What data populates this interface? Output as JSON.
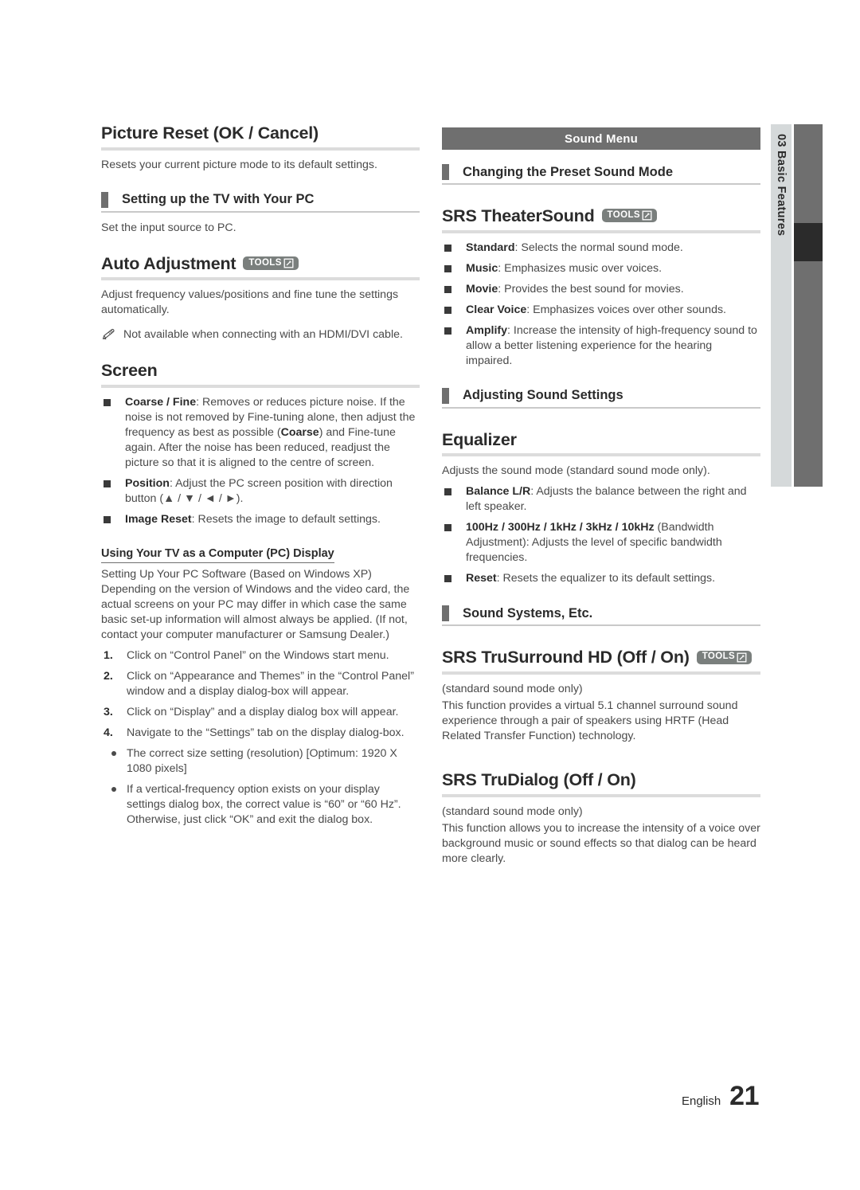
{
  "document": {
    "banner": "Sound Menu",
    "side_tab": {
      "number": "03",
      "label": "Basic Features",
      "combined": "03  Basic Features"
    },
    "footer": {
      "language": "English",
      "page_number": "21"
    },
    "colors": {
      "banner_bg": "#6f6f6f",
      "side_tab_bg": "#d5d9da",
      "sidebar_strip": "#6f6f6f",
      "sidebar_marker": "#2b2b2b",
      "tools_badge": "#7a7f7d",
      "heading_rule": "#dcdcdc",
      "text": "#4a4a4a"
    }
  },
  "left_column": {
    "picture_reset": {
      "title": "Picture Reset (OK / Cancel)",
      "body": "Resets your current picture mode to its default settings."
    },
    "setting_up_tv": {
      "section_title": "Setting up the TV with Your PC",
      "body": "Set the input source to PC."
    },
    "auto_adjustment": {
      "title": "Auto Adjustment",
      "tools_label": "TOOLS",
      "body": "Adjust frequency values/positions and fine tune the settings automatically.",
      "note": "Not available when connecting with an HDMI/DVI cable."
    },
    "screen": {
      "title": "Screen",
      "items": [
        {
          "term": "Coarse / Fine",
          "desc": ": Removes or reduces picture noise. If the noise is not removed by Fine-tuning alone, then adjust the frequency as best as possible (",
          "term2": "Coarse",
          "desc2": ") and Fine-tune again. After the noise has been reduced, readjust the picture so that it is aligned to the centre of screen."
        },
        {
          "term": "Position",
          "desc": ": Adjust the PC screen position with direction button (▲ / ▼ / ◄ / ►)."
        },
        {
          "term": "Image Reset",
          "desc": ": Resets the image to default settings."
        }
      ]
    },
    "pc_display": {
      "subhead": "Using Your TV as a Computer (PC) Display",
      "intro": "Setting Up Your PC Software (Based on Windows XP) Depending on the version of Windows and the video card, the actual screens on your PC may differ in which case the same basic set-up information will almost always be applied. (If not, contact your computer manufacturer or Samsung Dealer.)",
      "steps": [
        {
          "n": "1.",
          "text": "Click on “Control Panel” on the Windows start menu."
        },
        {
          "n": "2.",
          "text": "Click on “Appearance and Themes” in the “Control Panel” window and a display dialog-box will appear."
        },
        {
          "n": "3.",
          "text": "Click on “Display” and a display dialog box will appear."
        },
        {
          "n": "4.",
          "text": "Navigate to the “Settings” tab on the display dialog-box."
        }
      ],
      "bullets": [
        "The correct size setting (resolution) [Optimum: 1920 X 1080 pixels]",
        "If a vertical-frequency option exists on your display settings dialog box, the correct value is “60” or “60 Hz”. Otherwise, just click “OK” and exit the dialog box."
      ]
    }
  },
  "right_column": {
    "preset_sound_mode": {
      "section_title": "Changing the Preset Sound Mode"
    },
    "srs_theatersound": {
      "title": "SRS TheaterSound",
      "tools_label": "TOOLS",
      "items": [
        {
          "term": "Standard",
          "desc": ": Selects the normal sound mode."
        },
        {
          "term": "Music",
          "desc": ": Emphasizes music over voices."
        },
        {
          "term": "Movie",
          "desc": ": Provides the best sound for movies."
        },
        {
          "term": "Clear Voice",
          "desc": ": Emphasizes voices over other sounds."
        },
        {
          "term": "Amplify",
          "desc": ": Increase the intensity of high-frequency sound to allow a better listening experience for the hearing impaired."
        }
      ]
    },
    "adjusting_sound_settings": {
      "section_title": "Adjusting Sound Settings"
    },
    "equalizer": {
      "title": "Equalizer",
      "body": "Adjusts the sound mode (standard sound mode only).",
      "items": [
        {
          "term": "Balance L/R",
          "desc": ": Adjusts the balance between the right and left speaker."
        },
        {
          "term": "100Hz / 300Hz / 1kHz / 3kHz / 10kHz",
          "desc": " (Bandwidth Adjustment): Adjusts the level of specific bandwidth frequencies."
        },
        {
          "term": "Reset",
          "desc": ": Resets the equalizer to its default settings."
        }
      ]
    },
    "sound_systems_etc": {
      "section_title": "Sound Systems, Etc."
    },
    "srs_trusurround": {
      "title": "SRS TruSurround HD (Off / On)",
      "tools_label": "TOOLS",
      "note": "(standard sound mode only)",
      "body": "This function provides a virtual 5.1 channel surround sound experience through a pair of speakers using HRTF (Head Related Transfer Function) technology."
    },
    "srs_trudialog": {
      "title": "SRS TruDialog (Off / On)",
      "note": "(standard sound mode only)",
      "body": "This function allows you to increase the intensity of a voice over background music or sound effects so that dialog can be heard more clearly."
    }
  }
}
